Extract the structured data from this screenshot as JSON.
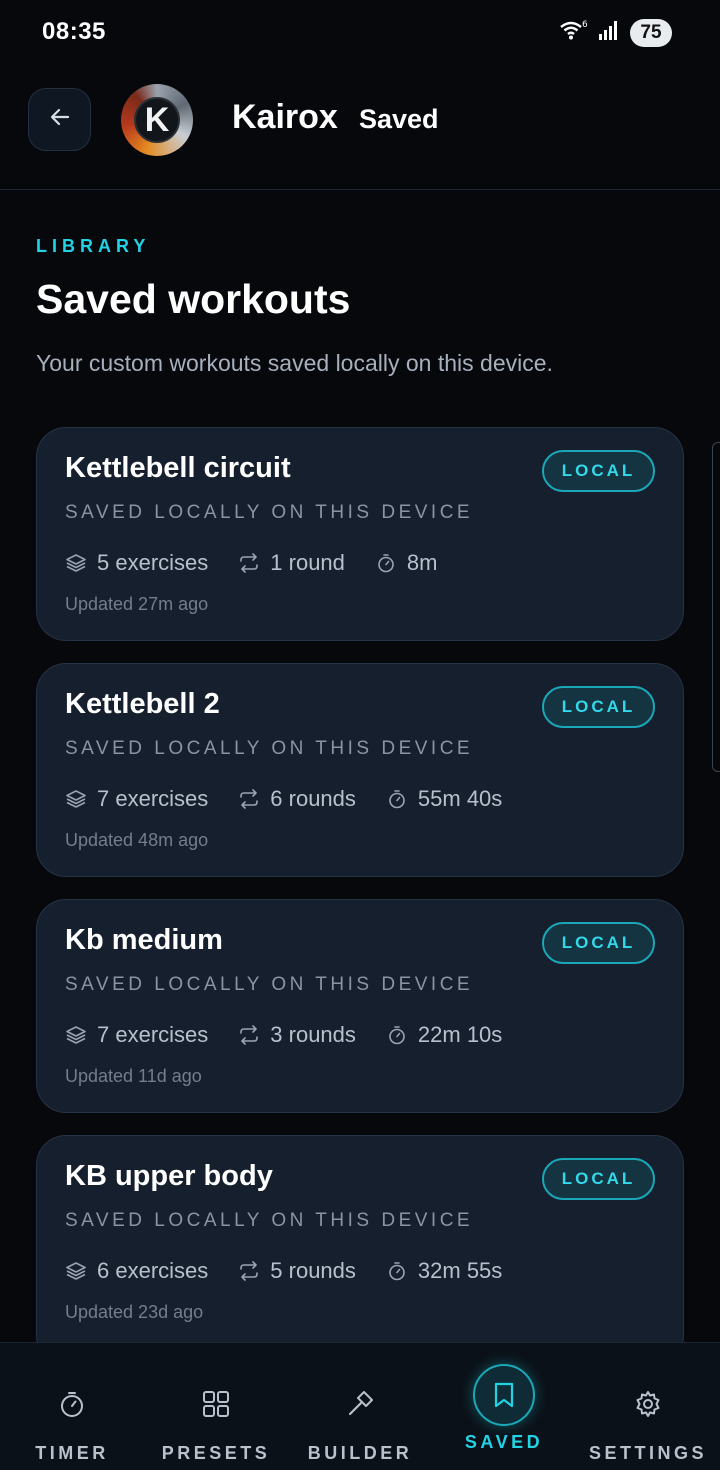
{
  "status_bar": {
    "time": "08:35",
    "battery": "75",
    "wifi_label": "6"
  },
  "header": {
    "back_icon": "arrow-left-icon",
    "logo_letter": "K",
    "app_name": "Kairox",
    "page_name": "Saved"
  },
  "intro": {
    "eyebrow": "LIBRARY",
    "title": "Saved workouts",
    "subtitle": "Your custom workouts saved locally on this device."
  },
  "workouts": [
    {
      "title": "Kettlebell circuit",
      "badge": "LOCAL",
      "subtitle": "SAVED LOCALLY ON THIS DEVICE",
      "exercises": "5 exercises",
      "rounds": "1 round",
      "duration": "8m",
      "updated": "Updated 27m ago"
    },
    {
      "title": "Kettlebell 2",
      "badge": "LOCAL",
      "subtitle": "SAVED LOCALLY ON THIS DEVICE",
      "exercises": "7 exercises",
      "rounds": "6 rounds",
      "duration": "55m 40s",
      "updated": "Updated 48m ago"
    },
    {
      "title": "Kb medium",
      "badge": "LOCAL",
      "subtitle": "SAVED LOCALLY ON THIS DEVICE",
      "exercises": "7 exercises",
      "rounds": "3 rounds",
      "duration": "22m 10s",
      "updated": "Updated 11d ago"
    },
    {
      "title": "KB upper body",
      "badge": "LOCAL",
      "subtitle": "SAVED LOCALLY ON THIS DEVICE",
      "exercises": "6 exercises",
      "rounds": "5 rounds",
      "duration": "32m 55s",
      "updated": "Updated 23d ago"
    }
  ],
  "nav": {
    "items": [
      {
        "label": "TIMER",
        "icon": "stopwatch-icon"
      },
      {
        "label": "PRESETS",
        "icon": "grid-icon"
      },
      {
        "label": "BUILDER",
        "icon": "hammer-icon"
      },
      {
        "label": "SAVED",
        "icon": "bookmark-icon"
      },
      {
        "label": "SETTINGS",
        "icon": "gear-icon"
      }
    ],
    "active": "SAVED"
  },
  "colors": {
    "accent": "#22d3e6",
    "background": "#06080c",
    "card": "#151f2d"
  }
}
